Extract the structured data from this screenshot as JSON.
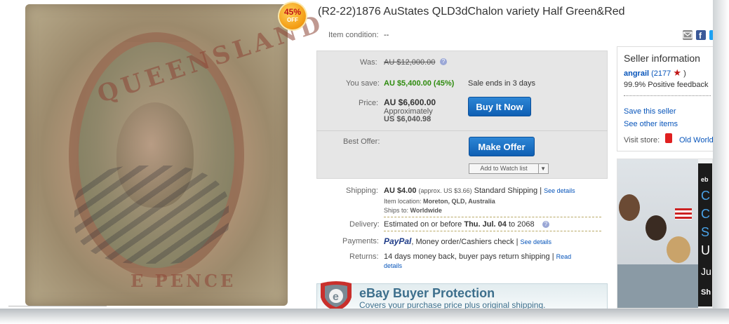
{
  "listing": {
    "title": "(R2-22)1876 AuStates QLD3dChalon variety Half Green&Red",
    "discount_badge": {
      "percent": "45%",
      "off": "OFF"
    },
    "stamp_image": {
      "top_text": "QUEENSLAND",
      "bottom_text": "E PENCE"
    }
  },
  "item_condition": {
    "label": "Item condition:",
    "value": "--"
  },
  "pricing": {
    "was_label": "Was:",
    "was_value": "AU $12,000.00",
    "you_save_label": "You save:",
    "you_save_value": "AU $5,400.00 (45%)",
    "sale_ends": "Sale ends in 3 days",
    "price_label": "Price:",
    "price_value": "AU $6,600.00",
    "approx_label": "Approximately",
    "approx_value": "US $6,040.98",
    "buy_now": "Buy It Now",
    "best_offer_label": "Best Offer:",
    "make_offer": "Make Offer",
    "watch_list": "Add to Watch list"
  },
  "shipping": {
    "label": "Shipping:",
    "cost": "AU $4.00",
    "approx": "(approx. US $3.66)",
    "method": "Standard Shipping",
    "sep": "|",
    "see_details": "See details",
    "location_label": "Item location:",
    "location": "Moreton, QLD, Australia",
    "ships_to_label": "Ships to:",
    "ships_to": "Worldwide"
  },
  "delivery": {
    "label": "Delivery:",
    "prefix": "Estimated on or before",
    "date": "Thu. Jul. 04",
    "suffix": "to 2068"
  },
  "payments": {
    "label": "Payments:",
    "paypal": "PayPal",
    "other": ", Money order/Cashiers check",
    "sep": "|",
    "see_details": "See details"
  },
  "returns": {
    "label": "Returns:",
    "text": "14 days money back, buyer pays return shipping",
    "sep": "|",
    "read_details": "Read details"
  },
  "protection": {
    "title": "eBay Buyer Protection",
    "subtitle": "Covers your purchase price plus original shipping."
  },
  "seller": {
    "heading": "Seller information",
    "name": "angrail",
    "feedback_count": "(2177",
    "feedback_close": ")",
    "positive": "99.9% Positive feedback",
    "save_seller": "Save this seller",
    "other_items": "See other items",
    "visit_store_label": "Visit store:",
    "store_name": "Old World"
  },
  "ad": {
    "brand": "eb",
    "letters": [
      "C",
      "C",
      "S",
      "U",
      "Ju",
      "Sh"
    ]
  },
  "colors": {
    "link": "#0654ba",
    "green": "#2e8b0e",
    "button": "#1569c7",
    "badge": "#f39b12"
  }
}
